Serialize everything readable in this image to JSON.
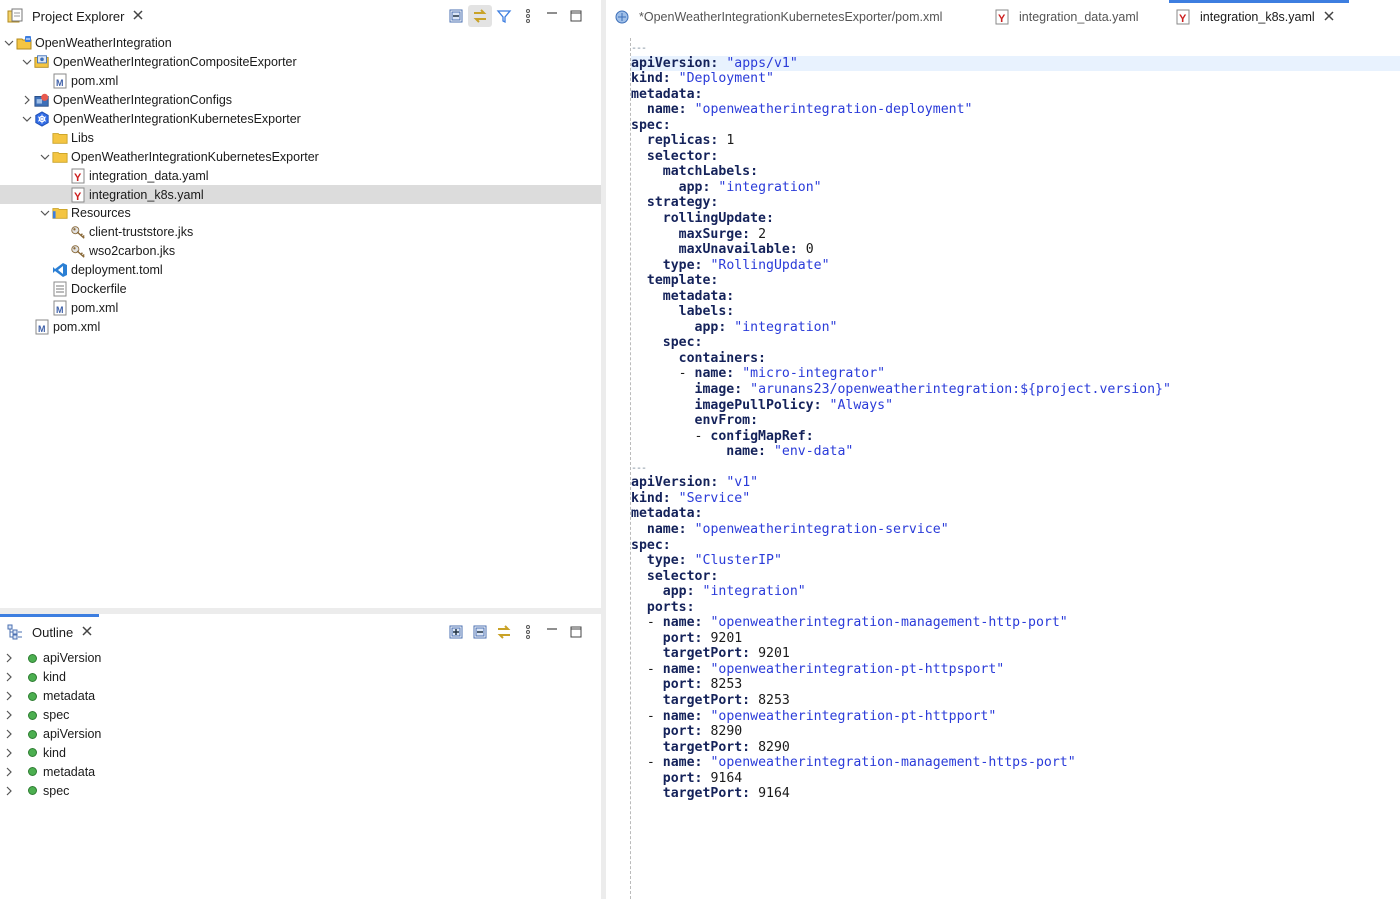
{
  "explorer": {
    "title": "Project Explorer",
    "tree": [
      {
        "label": "OpenWeatherIntegration",
        "depth": 0,
        "twisty": "open",
        "icon": "project-folder-icon"
      },
      {
        "label": "OpenWeatherIntegrationCompositeExporter",
        "depth": 1,
        "twisty": "open",
        "icon": "composite-exporter-icon"
      },
      {
        "label": "pom.xml",
        "depth": 2,
        "twisty": "none",
        "icon": "maven-file-icon"
      },
      {
        "label": "OpenWeatherIntegrationConfigs",
        "depth": 1,
        "twisty": "closed",
        "icon": "configs-project-icon"
      },
      {
        "label": "OpenWeatherIntegrationKubernetesExporter",
        "depth": 1,
        "twisty": "open",
        "icon": "kubernetes-icon"
      },
      {
        "label": "Libs",
        "depth": 2,
        "twisty": "none",
        "icon": "folder-icon"
      },
      {
        "label": "OpenWeatherIntegrationKubernetesExporter",
        "depth": 2,
        "twisty": "open",
        "icon": "folder-icon"
      },
      {
        "label": "integration_data.yaml",
        "depth": 3,
        "twisty": "none",
        "icon": "yaml-file-icon"
      },
      {
        "label": "integration_k8s.yaml",
        "depth": 3,
        "twisty": "none",
        "icon": "yaml-file-icon",
        "selected": true
      },
      {
        "label": "Resources",
        "depth": 2,
        "twisty": "open",
        "icon": "resources-folder-icon"
      },
      {
        "label": "client-truststore.jks",
        "depth": 3,
        "twisty": "none",
        "icon": "keystore-icon"
      },
      {
        "label": "wso2carbon.jks",
        "depth": 3,
        "twisty": "none",
        "icon": "keystore-icon"
      },
      {
        "label": "deployment.toml",
        "depth": 2,
        "twisty": "none",
        "icon": "vscode-file-icon"
      },
      {
        "label": "Dockerfile",
        "depth": 2,
        "twisty": "none",
        "icon": "text-file-icon"
      },
      {
        "label": "pom.xml",
        "depth": 2,
        "twisty": "none",
        "icon": "maven-file-icon"
      },
      {
        "label": "pom.xml",
        "depth": 1,
        "twisty": "none",
        "icon": "maven-file-icon"
      }
    ]
  },
  "outline": {
    "title": "Outline",
    "items": [
      "apiVersion",
      "kind",
      "metadata",
      "spec",
      "apiVersion",
      "kind",
      "metadata",
      "spec"
    ]
  },
  "editor": {
    "tabs": [
      {
        "label": "*OpenWeatherIntegrationKubernetesExporter/pom.xml",
        "icon": "maven-project-icon",
        "active": false
      },
      {
        "label": "integration_data.yaml",
        "icon": "yaml-file-icon",
        "active": false
      },
      {
        "label": "integration_k8s.yaml",
        "icon": "yaml-file-icon",
        "active": true
      }
    ],
    "lines": [
      {
        "kind": "sep",
        "text": "---"
      },
      {
        "kind": "kv",
        "indent": 0,
        "key": "apiVersion",
        "value": "\"apps/v1\"",
        "vtype": "s",
        "current": true
      },
      {
        "kind": "kv",
        "indent": 0,
        "key": "kind",
        "value": "\"Deployment\"",
        "vtype": "s"
      },
      {
        "kind": "kv",
        "indent": 0,
        "key": "metadata",
        "value": "",
        "vtype": "s"
      },
      {
        "kind": "kv",
        "indent": 2,
        "key": "name",
        "value": "\"openweatherintegration-deployment\"",
        "vtype": "s"
      },
      {
        "kind": "kv",
        "indent": 0,
        "key": "spec",
        "value": "",
        "vtype": "s"
      },
      {
        "kind": "kv",
        "indent": 2,
        "key": "replicas",
        "value": "1",
        "vtype": "n"
      },
      {
        "kind": "kv",
        "indent": 2,
        "key": "selector",
        "value": "",
        "vtype": "s"
      },
      {
        "kind": "kv",
        "indent": 4,
        "key": "matchLabels",
        "value": "",
        "vtype": "s"
      },
      {
        "kind": "kv",
        "indent": 6,
        "key": "app",
        "value": "\"integration\"",
        "vtype": "s"
      },
      {
        "kind": "kv",
        "indent": 2,
        "key": "strategy",
        "value": "",
        "vtype": "s"
      },
      {
        "kind": "kv",
        "indent": 4,
        "key": "rollingUpdate",
        "value": "",
        "vtype": "s"
      },
      {
        "kind": "kv",
        "indent": 6,
        "key": "maxSurge",
        "value": "2",
        "vtype": "n"
      },
      {
        "kind": "kv",
        "indent": 6,
        "key": "maxUnavailable",
        "value": "0",
        "vtype": "n"
      },
      {
        "kind": "kv",
        "indent": 4,
        "key": "type",
        "value": "\"RollingUpdate\"",
        "vtype": "s"
      },
      {
        "kind": "kv",
        "indent": 2,
        "key": "template",
        "value": "",
        "vtype": "s"
      },
      {
        "kind": "kv",
        "indent": 4,
        "key": "metadata",
        "value": "",
        "vtype": "s"
      },
      {
        "kind": "kv",
        "indent": 6,
        "key": "labels",
        "value": "",
        "vtype": "s"
      },
      {
        "kind": "kv",
        "indent": 8,
        "key": "app",
        "value": "\"integration\"",
        "vtype": "s"
      },
      {
        "kind": "kv",
        "indent": 4,
        "key": "spec",
        "value": "",
        "vtype": "s"
      },
      {
        "kind": "kv",
        "indent": 6,
        "key": "containers",
        "value": "",
        "vtype": "s"
      },
      {
        "kind": "kv",
        "indent": 6,
        "dash": true,
        "key": "name",
        "value": "\"micro-integrator\"",
        "vtype": "s"
      },
      {
        "kind": "kv",
        "indent": 8,
        "key": "image",
        "value": "\"arunans23/openweatherintegration:${project.version}\"",
        "vtype": "s"
      },
      {
        "kind": "kv",
        "indent": 8,
        "key": "imagePullPolicy",
        "value": "\"Always\"",
        "vtype": "s"
      },
      {
        "kind": "kv",
        "indent": 8,
        "key": "envFrom",
        "value": "",
        "vtype": "s"
      },
      {
        "kind": "kv",
        "indent": 8,
        "dash": true,
        "key": "configMapRef",
        "value": "",
        "vtype": "s"
      },
      {
        "kind": "kv",
        "indent": 12,
        "key": "name",
        "value": "\"env-data\"",
        "vtype": "s"
      },
      {
        "kind": "sep",
        "text": "---"
      },
      {
        "kind": "kv",
        "indent": 0,
        "key": "apiVersion",
        "value": "\"v1\"",
        "vtype": "s"
      },
      {
        "kind": "kv",
        "indent": 0,
        "key": "kind",
        "value": "\"Service\"",
        "vtype": "s"
      },
      {
        "kind": "kv",
        "indent": 0,
        "key": "metadata",
        "value": "",
        "vtype": "s"
      },
      {
        "kind": "kv",
        "indent": 2,
        "key": "name",
        "value": "\"openweatherintegration-service\"",
        "vtype": "s"
      },
      {
        "kind": "kv",
        "indent": 0,
        "key": "spec",
        "value": "",
        "vtype": "s"
      },
      {
        "kind": "kv",
        "indent": 2,
        "key": "type",
        "value": "\"ClusterIP\"",
        "vtype": "s"
      },
      {
        "kind": "kv",
        "indent": 2,
        "key": "selector",
        "value": "",
        "vtype": "s"
      },
      {
        "kind": "kv",
        "indent": 4,
        "key": "app",
        "value": "\"integration\"",
        "vtype": "s"
      },
      {
        "kind": "kv",
        "indent": 2,
        "key": "ports",
        "value": "",
        "vtype": "s"
      },
      {
        "kind": "kv",
        "indent": 2,
        "dash": true,
        "key": "name",
        "value": "\"openweatherintegration-management-http-port\"",
        "vtype": "s"
      },
      {
        "kind": "kv",
        "indent": 4,
        "key": "port",
        "value": "9201",
        "vtype": "n"
      },
      {
        "kind": "kv",
        "indent": 4,
        "key": "targetPort",
        "value": "9201",
        "vtype": "n"
      },
      {
        "kind": "kv",
        "indent": 2,
        "dash": true,
        "key": "name",
        "value": "\"openweatherintegration-pt-httpsport\"",
        "vtype": "s"
      },
      {
        "kind": "kv",
        "indent": 4,
        "key": "port",
        "value": "8253",
        "vtype": "n"
      },
      {
        "kind": "kv",
        "indent": 4,
        "key": "targetPort",
        "value": "8253",
        "vtype": "n"
      },
      {
        "kind": "kv",
        "indent": 2,
        "dash": true,
        "key": "name",
        "value": "\"openweatherintegration-pt-httpport\"",
        "vtype": "s"
      },
      {
        "kind": "kv",
        "indent": 4,
        "key": "port",
        "value": "8290",
        "vtype": "n"
      },
      {
        "kind": "kv",
        "indent": 4,
        "key": "targetPort",
        "value": "8290",
        "vtype": "n"
      },
      {
        "kind": "kv",
        "indent": 2,
        "dash": true,
        "key": "name",
        "value": "\"openweatherintegration-management-https-port\"",
        "vtype": "s"
      },
      {
        "kind": "kv",
        "indent": 4,
        "key": "port",
        "value": "9164",
        "vtype": "n"
      },
      {
        "kind": "kv",
        "indent": 4,
        "key": "targetPort",
        "value": "9164",
        "vtype": "n"
      }
    ]
  },
  "colors": {
    "accent": "#3d7ee0",
    "key": "#14225a",
    "string": "#2a3bd9",
    "selection": "#dcdcdc",
    "outline_dot": "#4caf50"
  }
}
